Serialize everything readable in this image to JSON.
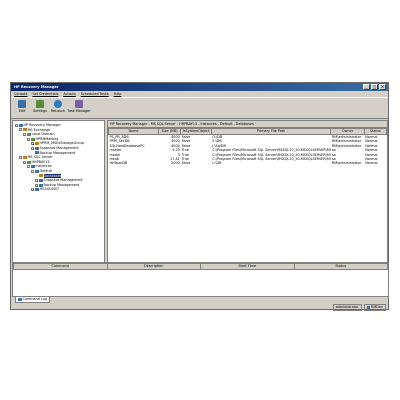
{
  "window": {
    "title": "HP Recovery Manager"
  },
  "menu": [
    "Console",
    "Set Credentials",
    "Actions",
    "Scheduled Tasks",
    "Help"
  ],
  "toolbar": [
    {
      "label": "Edit",
      "icon": "edit-icon"
    },
    {
      "label": "Settings",
      "icon": "settings-icon"
    },
    {
      "label": "ReLauch",
      "icon": "relaunch-icon"
    },
    {
      "label": "Task Manager",
      "icon": "task-manager-icon"
    }
  ],
  "tree": [
    {
      "label": "HP Recovery Manager",
      "level": 0,
      "exp": "-"
    },
    {
      "label": "MS Exchange",
      "level": 1,
      "exp": "-"
    },
    {
      "label": "Local Domain",
      "level": 2,
      "exp": "-"
    },
    {
      "label": "HPRMMailbox",
      "level": 3,
      "exp": "-"
    },
    {
      "label": "HPRM_MSExStorageGroup",
      "level": 4,
      "exp": "+"
    },
    {
      "label": "Snapshot Management",
      "level": 4,
      "exp": "+"
    },
    {
      "label": "Backup Management",
      "level": 4,
      "exp": ""
    },
    {
      "label": "MS SQL Server",
      "level": 1,
      "exp": "-"
    },
    {
      "label": "HHPBAY13",
      "level": 2,
      "exp": "-"
    },
    {
      "label": "Instances",
      "level": 3,
      "exp": "-"
    },
    {
      "label": "Default",
      "level": 4,
      "exp": "-"
    },
    {
      "label": "Databases",
      "level": 5,
      "exp": "",
      "selected": true
    },
    {
      "label": "Snapshot Management",
      "level": 5,
      "exp": "+"
    },
    {
      "label": "Backup Management",
      "level": 5,
      "exp": "+"
    },
    {
      "label": "MSSQLINST",
      "level": 4,
      "exp": "+"
    }
  ],
  "breadcrumb": "HP Recovery Manager - MS SQL Server - HHPBAY13 - Instances - Default - Databases",
  "db_table": {
    "columns": [
      "Name",
      "Size (MB)",
      "IsSystemObject",
      "Primary File Path",
      "Owner",
      "Status"
    ],
    "rows": [
      [
        "PS_PR_ADB",
        "4000",
        "False",
        "G:\\DB",
        "RM\\administrator",
        "Normal"
      ],
      [
        "PRM_SecDB",
        "3000",
        "False",
        "E:\\DB",
        "RM\\administrator",
        "Normal"
      ],
      [
        "SQLHostDatabasePC",
        "4000",
        "False",
        "J:\\SqlDB",
        "RM\\administrator",
        "Normal"
      ],
      [
        "master",
        "5.25",
        "True",
        "C:\\Program Files\\Microsoft SQL Server\\MSSQL10_50.MSSQLSERVER\\MSSQL\\DATA",
        "sa",
        "Normal"
      ],
      [
        "model",
        "3",
        "True",
        "C:\\Program Files\\Microsoft SQL Server\\MSSQL10_50.MSSQLSERVER\\MSSQL\\DATA",
        "sa",
        "Normal"
      ],
      [
        "msdb",
        "17.81",
        "True",
        "C:\\Program Files\\Microsoft SQL Server\\MSSQL10_50.MSSQLSERVER\\MSSQL\\DATA",
        "sa",
        "Normal"
      ],
      [
        "HkSpecDB",
        "2000",
        "False",
        "L:\\DB",
        "RM\\administrator",
        "Normal"
      ]
    ]
  },
  "task_table": {
    "columns": [
      "Command",
      "Description",
      "Start Time",
      "Status"
    ]
  },
  "bottom_tab": "Command Log",
  "status": {
    "user": "administrator",
    "host": "RMDev"
  }
}
